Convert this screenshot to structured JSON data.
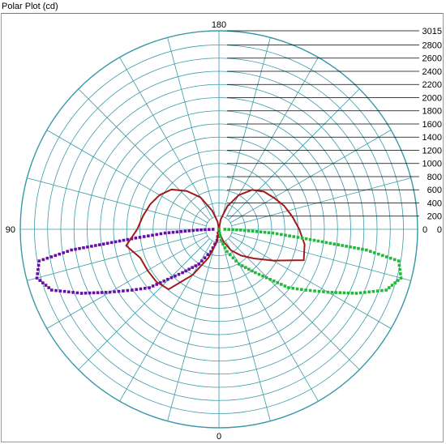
{
  "title": "Polar Plot (cd)",
  "colors": {
    "grid": "#3a9aa8",
    "leader": "#000000",
    "purple": "#6a0dad",
    "red": "#a11a1a",
    "green": "#1fba3a"
  },
  "chart_data": {
    "type": "polar",
    "title": "Polar Plot (cd)",
    "unit": "cd",
    "r_max": 3015,
    "r_ticks": [
      3015,
      2800,
      2600,
      2400,
      2200,
      2000,
      1800,
      1600,
      1400,
      1200,
      1000,
      800,
      600,
      400,
      200,
      0
    ],
    "angle_labels": [
      {
        "label": "180",
        "position": "top"
      },
      {
        "label": "0",
        "position": "bottom"
      },
      {
        "label": "90",
        "position": "left"
      },
      {
        "label": "0",
        "position": "right"
      }
    ],
    "angular_grid_step_deg": 15,
    "series": [
      {
        "color": "purple",
        "style": "markers",
        "angle_deg": [
          0,
          10,
          20,
          30,
          40,
          50,
          55,
          60,
          65,
          70,
          75,
          80,
          82,
          84,
          86,
          88,
          90
        ],
        "values": [
          0,
          170,
          360,
          610,
          860,
          1380,
          1610,
          1910,
          2300,
          2700,
          2860,
          2770,
          2260,
          1270,
          820,
          330,
          90
        ]
      },
      {
        "color": "red",
        "style": "line",
        "angle_deg": [
          0,
          10,
          20,
          30,
          40,
          50,
          60,
          70,
          80,
          90,
          100,
          110,
          120,
          130,
          140,
          150,
          160,
          170,
          180,
          190,
          200,
          210,
          220,
          230,
          240,
          250,
          260,
          270,
          280,
          290,
          300,
          310,
          320,
          330,
          340,
          350
        ],
        "values": [
          0,
          200,
          460,
          800,
          1190,
          1240,
          1250,
          1270,
          1430,
          1240,
          1170,
          1110,
          1040,
          940,
          760,
          560,
          300,
          120,
          0,
          150,
          370,
          600,
          780,
          890,
          960,
          1050,
          1130,
          1220,
          1320,
          1370,
          950,
          690,
          520,
          370,
          200,
          60
        ]
      },
      {
        "color": "green",
        "style": "markers",
        "angle_deg": [
          0,
          10,
          20,
          30,
          40,
          50,
          55,
          60,
          65,
          70,
          75,
          80,
          82,
          84,
          86,
          88,
          90
        ],
        "values": [
          0,
          170,
          360,
          610,
          860,
          1380,
          1610,
          1910,
          2300,
          2700,
          2860,
          2770,
          2260,
          1270,
          820,
          330,
          90
        ]
      }
    ]
  }
}
